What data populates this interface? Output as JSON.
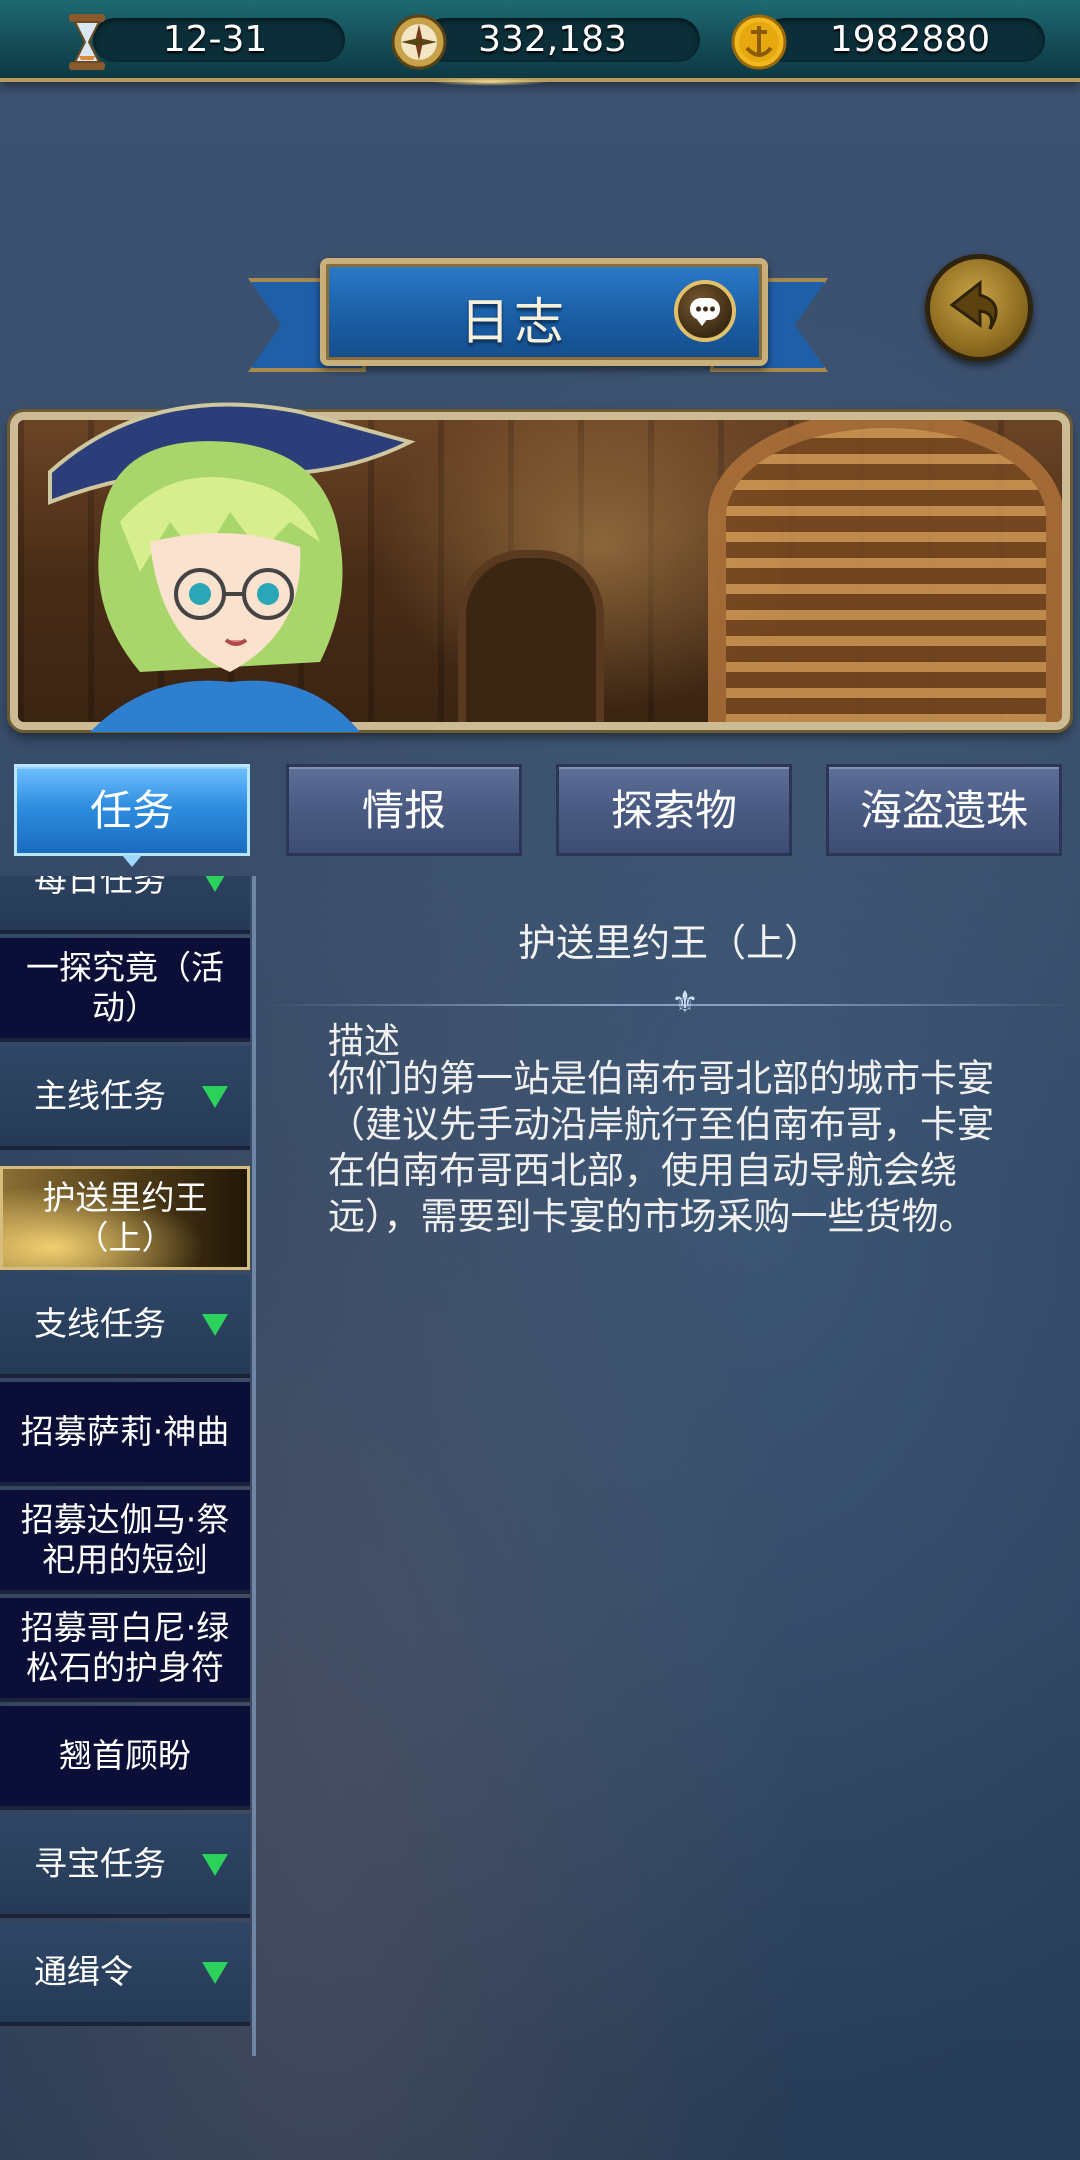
{
  "topbar": {
    "date": "12-31",
    "compass_value": "332,183",
    "gold_value": "1982880"
  },
  "header": {
    "title": "日志"
  },
  "tabs": [
    {
      "label": "任务",
      "active": true
    },
    {
      "label": "情报",
      "active": false
    },
    {
      "label": "探索物",
      "active": false
    },
    {
      "label": "海盗遗珠",
      "active": false
    }
  ],
  "sidebar": {
    "items": [
      {
        "label": "每日任务",
        "type": "category"
      },
      {
        "label": "一探究竟（活动）",
        "type": "entry"
      },
      {
        "label": "主线任务",
        "type": "category"
      },
      {
        "label": "护送里约王（上）",
        "type": "entry",
        "selected": true
      },
      {
        "label": "支线任务",
        "type": "category"
      },
      {
        "label": "招募萨莉·神曲",
        "type": "entry"
      },
      {
        "label": "招募达伽马·祭祀用的短剑",
        "type": "entry"
      },
      {
        "label": "招募哥白尼·绿松石的护身符",
        "type": "entry"
      },
      {
        "label": "翘首顾盼",
        "type": "entry"
      },
      {
        "label": "寻宝任务",
        "type": "category"
      },
      {
        "label": "通缉令",
        "type": "category"
      }
    ]
  },
  "content": {
    "title": "护送里约王（上）",
    "desc_label": "描述",
    "desc_text": "你们的第一站是伯南布哥北部的城市卡宴（建议先手动沿岸航行至伯南布哥，卡宴在伯南布哥西北部，使用自动导航会绕远），需要到卡宴的市场采购一些货物。"
  },
  "colors": {
    "active_tab": "#2f8ee0",
    "category_arrow": "#2cd15b",
    "topbar": "#134a55"
  }
}
